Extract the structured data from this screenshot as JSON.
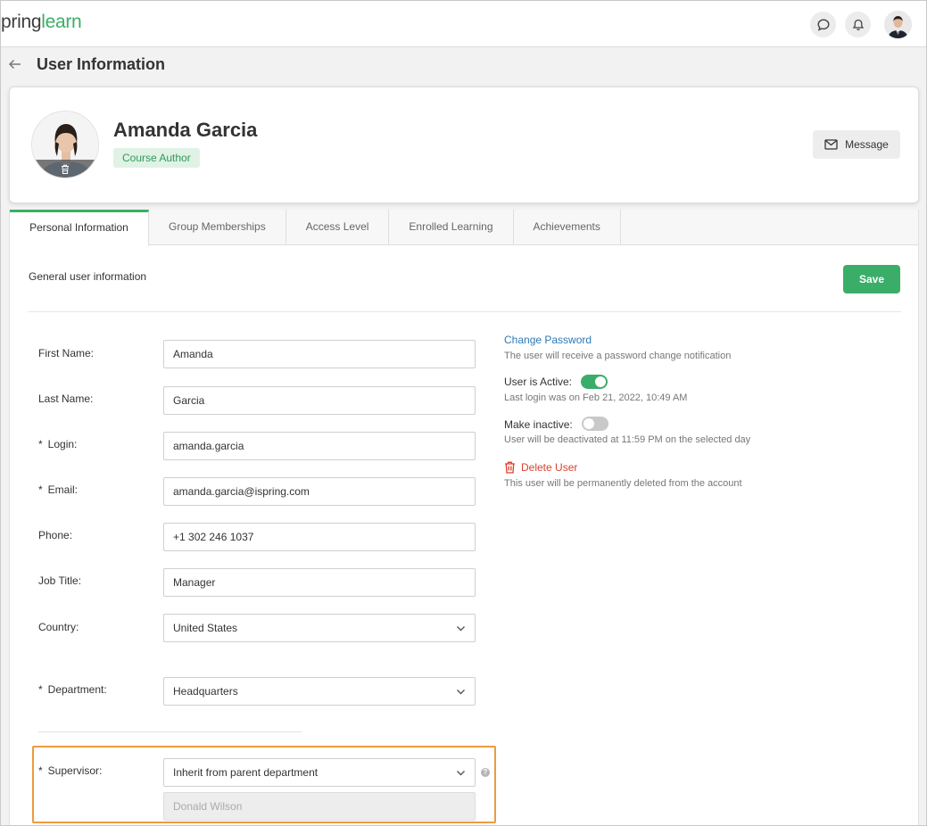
{
  "header": {
    "logo_part1": "pring",
    "logo_part2": "learn"
  },
  "page": {
    "title": "User Information"
  },
  "profile": {
    "name": "Amanda Garcia",
    "role": "Course Author",
    "message_label": "Message"
  },
  "tabs": [
    {
      "label": "Personal Information",
      "active": true
    },
    {
      "label": "Group Memberships",
      "active": false
    },
    {
      "label": "Access Level",
      "active": false
    },
    {
      "label": "Enrolled Learning",
      "active": false
    },
    {
      "label": "Achievements",
      "active": false
    }
  ],
  "form": {
    "section_label": "General user information",
    "save_label": "Save",
    "fields": {
      "first_name": {
        "label": "First Name:",
        "value": "Amanda"
      },
      "last_name": {
        "label": "Last Name:",
        "value": "Garcia"
      },
      "login": {
        "label": "Login:",
        "value": "amanda.garcia",
        "required": "*"
      },
      "email": {
        "label": "Email:",
        "value": "amanda.garcia@ispring.com",
        "required": "*"
      },
      "phone": {
        "label": "Phone:",
        "value": "+1 302 246 1037"
      },
      "job_title": {
        "label": "Job Title:",
        "value": "Manager"
      },
      "country": {
        "label": "Country:",
        "value": "United States"
      },
      "department": {
        "label": "Department:",
        "value": "Headquarters",
        "required": "*"
      },
      "supervisor": {
        "label": "Supervisor:",
        "value": "Inherit from parent department",
        "required": "*",
        "inherited_value": "Donald Wilson"
      }
    }
  },
  "account": {
    "change_password": {
      "label": "Change Password",
      "hint": "The user will receive a password change notification"
    },
    "active": {
      "label": "User is Active:",
      "on": true,
      "hint": "Last login was on Feb 21, 2022, 10:49 AM"
    },
    "inactive": {
      "label": "Make inactive:",
      "on": false,
      "hint": "User will be deactivated at 11:59 PM on the selected day"
    },
    "delete": {
      "label": "Delete User",
      "hint": "This user will be permanently deleted from the account"
    }
  },
  "colors": {
    "accent": "#3aae68",
    "link": "#2b79b8",
    "danger": "#d9412f",
    "highlight": "#ee9a3e"
  }
}
